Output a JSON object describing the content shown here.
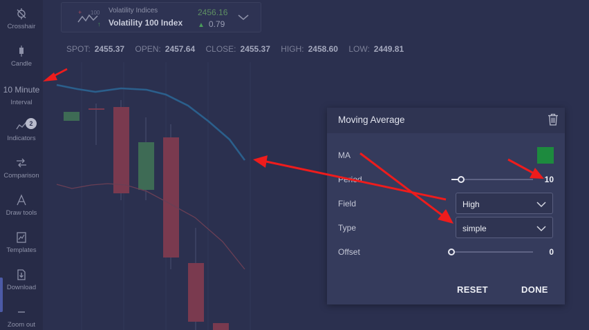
{
  "sidebar": {
    "items": [
      {
        "label": "Crosshair",
        "icon": "crosshair-icon"
      },
      {
        "label": "Candle",
        "icon": "candle-icon"
      },
      {
        "label": "Interval",
        "value": "10 Minute"
      },
      {
        "label": "Indicators",
        "icon": "indicators-icon",
        "badge": "2"
      },
      {
        "label": "Comparison",
        "icon": "comparison-icon"
      },
      {
        "label": "Draw tools",
        "icon": "draw-tools-icon"
      },
      {
        "label": "Templates",
        "icon": "templates-icon"
      },
      {
        "label": "Download",
        "icon": "download-icon"
      },
      {
        "label": "Zoom out",
        "icon": "zoom-out-icon"
      }
    ]
  },
  "market": {
    "category": "Volatility Indices",
    "name": "Volatility 100 Index",
    "price": "2456.16",
    "change": "0.79",
    "icon_badge": "100"
  },
  "ohlc": {
    "spot_label": "SPOT:",
    "spot": "2455.37",
    "open_label": "OPEN:",
    "open": "2457.64",
    "close_label": "CLOSE:",
    "close": "2455.37",
    "high_label": "HIGH:",
    "high": "2458.60",
    "low_label": "LOW:",
    "low": "2449.81"
  },
  "dialog": {
    "title": "Moving Average",
    "ma_label": "MA",
    "ma_color": "#1d8a3e",
    "period_label": "Period",
    "period_value": "10",
    "period_fraction": 0.12,
    "field_label": "Field",
    "field_value": "High",
    "type_label": "Type",
    "type_value": "simple",
    "offset_label": "Offset",
    "offset_value": "0",
    "offset_fraction": 0,
    "reset_label": "RESET",
    "done_label": "DONE"
  },
  "colors": {
    "background": "#2b304f",
    "bull_candle": "#3e6b55",
    "bear_candle": "#7a3a4f",
    "ma_line": "#2b5f8c",
    "ma_line_secondary": "#6a3f55",
    "annotation_arrow": "#ee1c1c"
  }
}
